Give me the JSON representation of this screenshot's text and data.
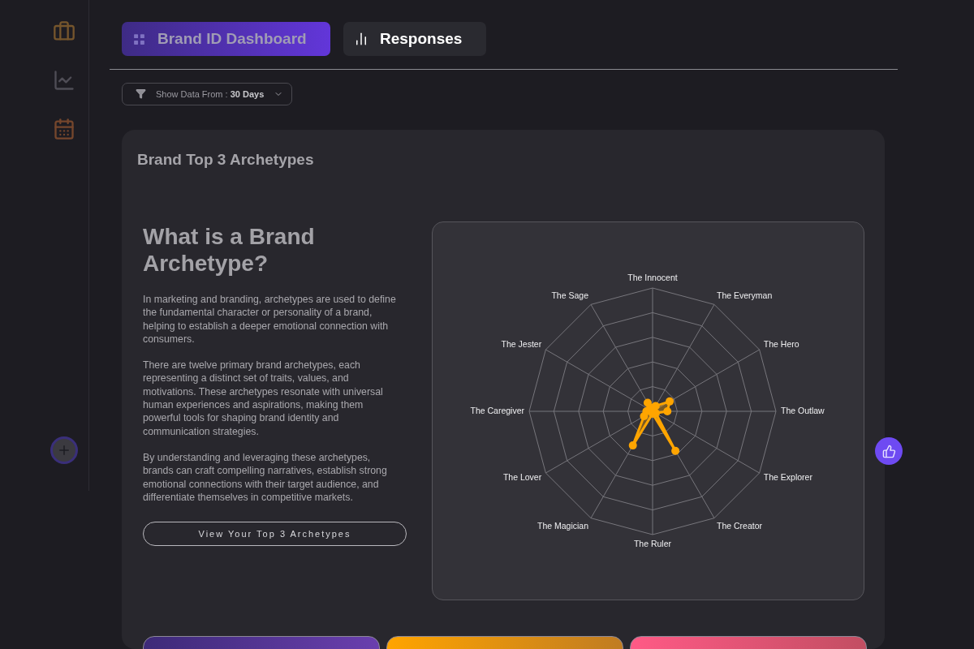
{
  "tabs": [
    {
      "label": "Brand ID Dashboard",
      "selected": true
    },
    {
      "label": "Responses",
      "selected": false
    }
  ],
  "filter": {
    "text": "Show Data From : **30 Days**"
  },
  "card": {
    "title": "Brand Top 3 Archetypes",
    "heading": "What is a Brand Archetype?",
    "paragraphs": [
      "In marketing and branding, archetypes are used to define the fundamental character or personality of a brand, helping to establish a deeper emotional connection with consumers.",
      "There are twelve primary brand archetypes, each representing a distinct set of traits, values, and motivations. These archetypes resonate with universal human experiences and aspirations, making them powerful tools for shaping brand identity and communication strategies.",
      "By understanding and leveraging these archetypes, brands can craft compelling narratives, establish strong emotional connections with their target audience, and differentiate themselves in competitive markets."
    ],
    "button": "View Your Top 3 Archetypes",
    "radar": {
      "labels": [
        "The Innocent",
        "The Sage",
        "The Everyman",
        "The Jester",
        "The Hero",
        "The Caregiver",
        "The Outlaw",
        "The Lover",
        "The Explorer",
        "The Magician",
        "The Creator",
        "The Ruler"
      ]
    }
  }
}
